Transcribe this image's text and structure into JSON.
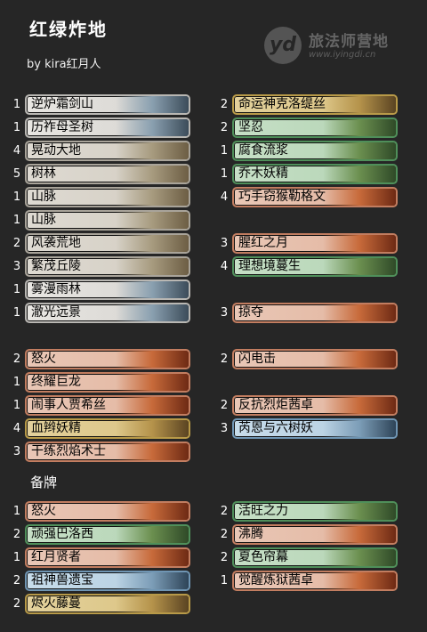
{
  "header": {
    "title": "红绿炸地",
    "byline": "by kira红月人",
    "logo_mark": "yd",
    "logo_name": "旅法师营地",
    "logo_url": "www.iyingdi.cn"
  },
  "sideboard_label": "备牌",
  "main_left": [
    {
      "count": "1",
      "name": "逆炉霜剑山",
      "color": "w"
    },
    {
      "count": "1",
      "name": "历祚母圣树",
      "color": "w"
    },
    {
      "count": "4",
      "name": "晃动大地",
      "color": "l"
    },
    {
      "count": "5",
      "name": "树林",
      "color": "l"
    },
    {
      "count": "1",
      "name": "山脉",
      "color": "l"
    },
    {
      "count": "1",
      "name": "山脉",
      "color": "l"
    },
    {
      "count": "2",
      "name": "风袭荒地",
      "color": "l"
    },
    {
      "count": "3",
      "name": "繁茂丘陵",
      "color": "l"
    },
    {
      "count": "1",
      "name": "雾漫雨林",
      "color": "w"
    },
    {
      "count": "1",
      "name": "澈光远景",
      "color": "w"
    },
    {
      "count": "2",
      "name": "怒火",
      "color": "r"
    },
    {
      "count": "1",
      "name": "终耀巨龙",
      "color": "r"
    },
    {
      "count": "1",
      "name": "闹事人贾希丝",
      "color": "r"
    },
    {
      "count": "4",
      "name": "血辫妖精",
      "color": "m"
    },
    {
      "count": "3",
      "name": "干练烈焰术士",
      "color": "r"
    }
  ],
  "main_right": [
    {
      "count": "2",
      "name": "命运神克洛缇丝",
      "color": "m"
    },
    {
      "count": "2",
      "name": "坚忍",
      "color": "g"
    },
    {
      "count": "1",
      "name": "腐食流浆",
      "color": "g"
    },
    {
      "count": "1",
      "name": "乔木妖精",
      "color": "g"
    },
    {
      "count": "4",
      "name": "巧手窃猴勒格文",
      "color": "r"
    },
    {
      "count": "3",
      "name": "腥红之月",
      "color": "r"
    },
    {
      "count": "4",
      "name": "理想境蔓生",
      "color": "g"
    },
    {
      "count": "3",
      "name": "掠夺",
      "color": "r"
    },
    {
      "count": "2",
      "name": "闪电击",
      "color": "r"
    },
    {
      "count": "2",
      "name": "反抗烈炬茜卓",
      "color": "r"
    },
    {
      "count": "3",
      "name": "芮恩与六树妖",
      "color": "b"
    }
  ],
  "side_left": [
    {
      "count": "1",
      "name": "怒火",
      "color": "r"
    },
    {
      "count": "2",
      "name": "顽强巴洛西",
      "color": "g"
    },
    {
      "count": "1",
      "name": "红月贤者",
      "color": "r"
    },
    {
      "count": "2",
      "name": "祖神兽遗宝",
      "color": "b"
    },
    {
      "count": "2",
      "name": "烬火藤蔓",
      "color": "m"
    }
  ],
  "side_right": [
    {
      "count": "2",
      "name": "活旺之力",
      "color": "g"
    },
    {
      "count": "2",
      "name": "沸腾",
      "color": "r"
    },
    {
      "count": "2",
      "name": "夏色帘幕",
      "color": "g"
    },
    {
      "count": "1",
      "name": "觉醒炼狱茜卓",
      "color": "r"
    }
  ]
}
